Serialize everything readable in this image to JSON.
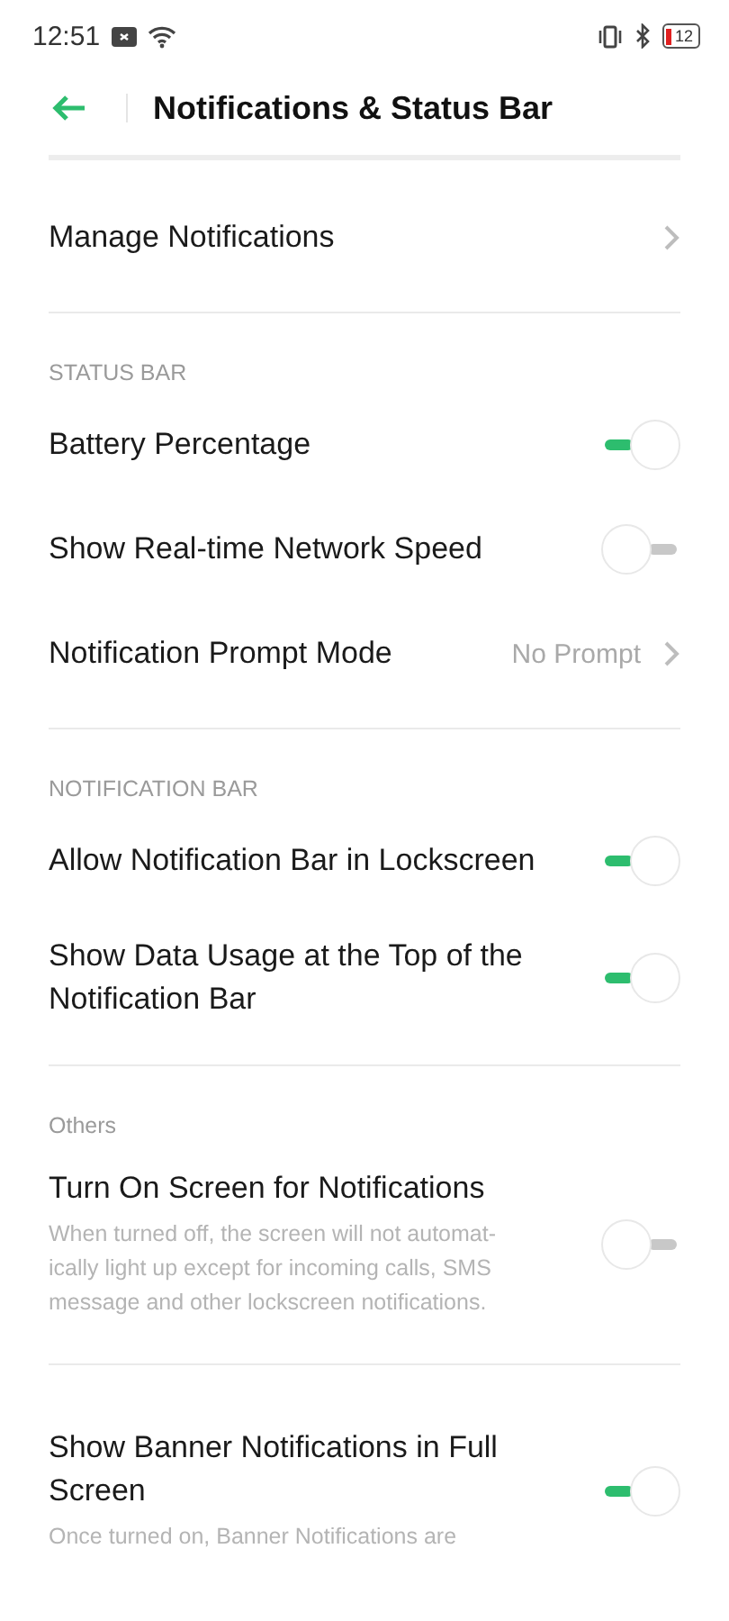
{
  "status_bar": {
    "time": "12:51",
    "battery": "12"
  },
  "header": {
    "title": "Notifications & Status Bar"
  },
  "sections": [
    {
      "items": [
        {
          "kind": "link",
          "label": "Manage Notifications"
        }
      ]
    },
    {
      "heading": "STATUS BAR",
      "items": [
        {
          "kind": "toggle",
          "label": "Battery Percentage",
          "on": true
        },
        {
          "kind": "toggle",
          "label": "Show Real-time Network Speed",
          "on": false
        },
        {
          "kind": "link",
          "label": "Notification Prompt Mode",
          "value": "No Prompt"
        }
      ]
    },
    {
      "heading": "NOTIFICATION BAR",
      "items": [
        {
          "kind": "toggle",
          "label": "Allow Notification Bar in Lockscreen",
          "on": true
        },
        {
          "kind": "toggle",
          "label": "Show Data Usage at the Top of the Notification Bar",
          "on": true
        }
      ]
    },
    {
      "heading": "Others",
      "items": [
        {
          "kind": "toggle",
          "label": "Turn On Screen for Notifications",
          "description": "When turned off, the screen will not automat-ically light up except for incoming calls, SMS message and other lockscreen notifications.",
          "on": false
        }
      ]
    },
    {
      "items": [
        {
          "kind": "toggle",
          "label": "Show Banner Notifications in Full Screen",
          "description": "Once turned on, Banner Notifications are",
          "on": true
        }
      ]
    }
  ]
}
